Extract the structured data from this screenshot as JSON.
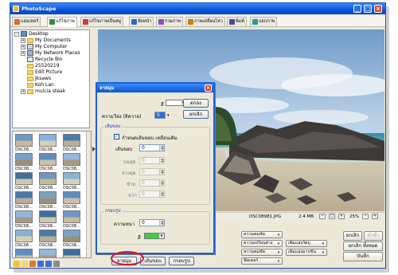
{
  "window": {
    "title": "PhotoScape",
    "controls": [
      "_",
      "□",
      "×"
    ]
  },
  "tabs": [
    {
      "label": "แฮมเทอร์",
      "icon": "home-icon",
      "color": "#e06b2a"
    },
    {
      "label": "แก้ไขภาพ",
      "icon": "edit-icon",
      "color": "#3c8c3c"
    },
    {
      "label": "แก้ไขภาพเป็นหมู่",
      "icon": "batch-icon",
      "color": "#c73c3c"
    },
    {
      "label": "จัดหน้า",
      "icon": "page-icon",
      "color": "#2a6ec9"
    },
    {
      "label": "รวมภาพ",
      "icon": "combine-icon",
      "color": "#8a4cc9"
    },
    {
      "label": "ภาพเคลื่อนไหว",
      "icon": "gif-icon",
      "color": "#d07d1a"
    },
    {
      "label": "พิมพ์",
      "icon": "print-icon",
      "color": "#4a4a9a"
    },
    {
      "label": "แยกภาพ",
      "icon": "split-icon",
      "color": "#2a9a9a"
    }
  ],
  "tree": [
    {
      "label": "Desktop",
      "icon": "desktop-icon",
      "indent": 0,
      "expander": "-"
    },
    {
      "label": "My Documents",
      "icon": "folder-icon",
      "indent": 1,
      "expander": "+"
    },
    {
      "label": "My Computer",
      "icon": "computer-icon",
      "indent": 1,
      "expander": "+"
    },
    {
      "label": "My Network Places",
      "icon": "network-icon",
      "indent": 1,
      "expander": "+"
    },
    {
      "label": "Recycle Bin",
      "icon": "recycle-bin-icon",
      "indent": 1,
      "expander": ""
    },
    {
      "label": "25520219",
      "icon": "folder-icon",
      "indent": 1,
      "expander": ""
    },
    {
      "label": "Edit Picture",
      "icon": "folder-icon",
      "indent": 1,
      "expander": ""
    },
    {
      "label": "Jksaws",
      "icon": "folder-icon",
      "indent": 1,
      "expander": ""
    },
    {
      "label": "Koh Lan",
      "icon": "folder-icon",
      "indent": 1,
      "expander": ""
    },
    {
      "label": "mulcia steak",
      "icon": "folder-icon",
      "indent": 1,
      "expander": "+"
    }
  ],
  "thumbnails": [
    "DSC08...",
    "DSC08...",
    "DSC08...",
    "DSC08...",
    "DSC08...",
    "DSC08...",
    "DSC08...",
    "DSC08...",
    "DSC08...",
    "DSC08...",
    "DSC08...",
    "DSC08...",
    "DSC08...",
    "DSC08...",
    "DSC08...",
    "DSC08...",
    "DSC08...",
    "DSC08...",
    "DSC08...",
    "DSC08...",
    "DSC08..."
  ],
  "photo_status": {
    "filename": "DSC08981.JPG",
    "filesize": "2.4 MB",
    "zoom": "25%"
  },
  "dialog": {
    "title": "ลายมุม",
    "color_label": "สี",
    "width_label": "ความวีล่ง (ลิควาอ)",
    "width_value": "5",
    "ok_label": "ตกลง",
    "cancel_label": "ยกเลิก",
    "border_group": {
      "label": "เส้นขอบ",
      "checkbox_label": "กำหนดเส้นขอบ เหมือนเดิม",
      "all_label": "เส้นขอบ",
      "all_value": "0",
      "top_label": "บนสุด",
      "top_value": "0",
      "bottom_label": "ล่างสุด",
      "bottom_value": "0",
      "left_label": "ซ้าย",
      "left_value": "0",
      "right_label": "ขวา",
      "right_value": "0"
    },
    "round_group": {
      "label": "กรอบรูป",
      "thickness_label": "ความหนา",
      "thickness_value": "0",
      "color_label": "สี"
    },
    "colors": {
      "main_color": "#ffffff",
      "width_swatch": "#3a68c9",
      "round_color": "#49c94a"
    }
  },
  "bottom_buttons": {
    "main_tab": "ลายมุม",
    "border_tab": "เส้นขอบ",
    "frame_tab": "กรอบรูป"
  },
  "tool_buttons": [
    {
      "label": "ความคมชัด"
    },
    {
      "label": "ความเปรียบต่าง"
    },
    {
      "label": "ความคมชัด"
    },
    {
      "label": "ฟิลเตอร์"
    },
    {
      "label": "เพิ่มแสงวัตถุ"
    },
    {
      "label": "เพิ่มแสงมากขึ้น"
    },
    {
      "label": "ยกเลิก"
    },
    {
      "label": "ทำซ้ำ"
    },
    {
      "label": "ยกเลิก ทั้งหมด"
    },
    {
      "label": "บันทึก"
    }
  ]
}
